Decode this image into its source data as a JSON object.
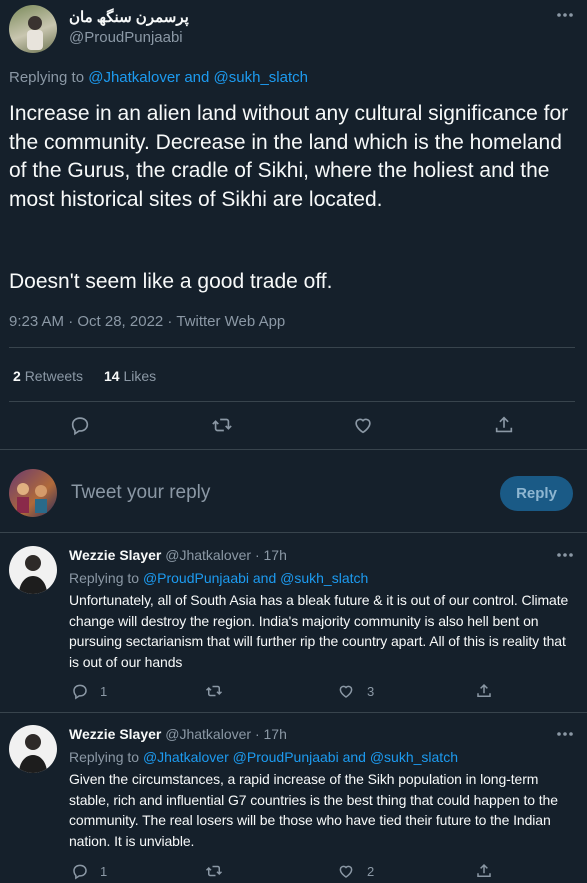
{
  "tweet": {
    "display_name": "پرسمرن سنگھ مان",
    "handle": "@ProudPunjaabi",
    "replying_prefix": "Replying to",
    "replying_to_1": "@Jhatkalover",
    "and": "and",
    "replying_to_2": "@sukh_slatch",
    "text_p1": "Increase in an alien land without any cultural significance for the community. Decrease in the land which is the homeland of the Gurus, the cradle of Sikhi, where the holiest and the most historical sites of Sikhi are located.",
    "text_p2": "Doesn't seem like a good trade off.",
    "timestamp": "9:23 AM · Oct 28, 2022 · Twitter Web App",
    "retweets_count": "2",
    "retweets_label": "Retweets",
    "likes_count": "14",
    "likes_label": "Likes"
  },
  "composer": {
    "placeholder": "Tweet your reply",
    "button_label": "Reply"
  },
  "replies": [
    {
      "name": "Wezzie Slayer",
      "handle": "@Jhatkalover",
      "sep": "·",
      "time": "17h",
      "replying_prefix": "Replying to",
      "mention_1": "@ProudPunjaabi",
      "and": "and",
      "mention_2": "@sukh_slatch",
      "text": "Unfortunately, all of South Asia has a bleak future & it is out of our control. Climate change will destroy the region. India's majority community is also hell bent on pursuing sectarianism that will further rip the country apart. All of this is reality that is out of our hands",
      "reply_count": "1",
      "like_count": "3"
    },
    {
      "name": "Wezzie Slayer",
      "handle": "@Jhatkalover",
      "sep": "·",
      "time": "17h",
      "replying_prefix": "Replying to",
      "mention_1": "@Jhatkalover",
      "mention_2": "@ProudPunjaabi",
      "and": "and",
      "mention_3": "@sukh_slatch",
      "text": "Given the circumstances, a rapid increase of the Sikh population in long-term stable, rich and influential G7 countries is the best thing that could happen to the community. The real losers will be those who have tied their future to the Indian nation. It is unviable.",
      "reply_count": "1",
      "like_count": "2"
    }
  ],
  "colors": {
    "bg": "#15202b",
    "text": "#f7f9f9",
    "muted": "#8b98a5",
    "accent": "#1d9bf0",
    "border": "#38444d",
    "button_bg": "#1a5a86"
  },
  "icons": [
    "reply-icon",
    "retweet-icon",
    "like-icon",
    "share-icon",
    "more-icon"
  ]
}
